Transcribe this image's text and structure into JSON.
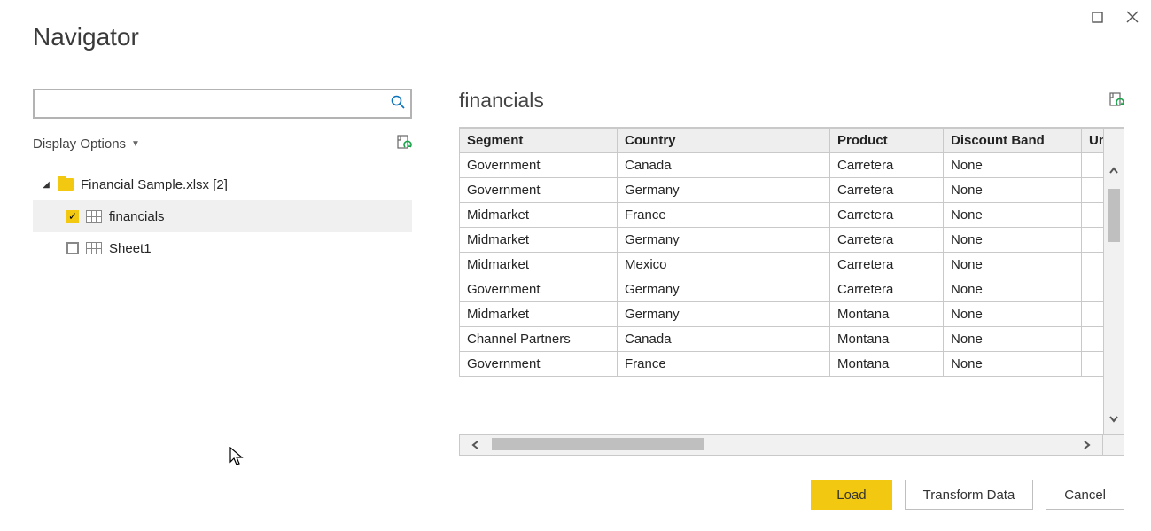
{
  "title": "Navigator",
  "search": {
    "placeholder": ""
  },
  "displayOptions": {
    "label": "Display Options"
  },
  "tree": {
    "file": {
      "label": "Financial Sample.xlsx [2]"
    },
    "items": [
      {
        "label": "financials",
        "checked": true,
        "selected": true
      },
      {
        "label": "Sheet1",
        "checked": false,
        "selected": false
      }
    ]
  },
  "preview": {
    "title": "financials",
    "columns": [
      "Segment",
      "Country",
      "Product",
      "Discount Band",
      "Uni"
    ],
    "rows": [
      [
        "Government",
        "Canada",
        "Carretera",
        "None",
        ""
      ],
      [
        "Government",
        "Germany",
        "Carretera",
        "None",
        ""
      ],
      [
        "Midmarket",
        "France",
        "Carretera",
        "None",
        ""
      ],
      [
        "Midmarket",
        "Germany",
        "Carretera",
        "None",
        ""
      ],
      [
        "Midmarket",
        "Mexico",
        "Carretera",
        "None",
        ""
      ],
      [
        "Government",
        "Germany",
        "Carretera",
        "None",
        ""
      ],
      [
        "Midmarket",
        "Germany",
        "Montana",
        "None",
        ""
      ],
      [
        "Channel Partners",
        "Canada",
        "Montana",
        "None",
        ""
      ],
      [
        "Government",
        "France",
        "Montana",
        "None",
        ""
      ]
    ]
  },
  "buttons": {
    "load": "Load",
    "transform": "Transform Data",
    "cancel": "Cancel"
  }
}
